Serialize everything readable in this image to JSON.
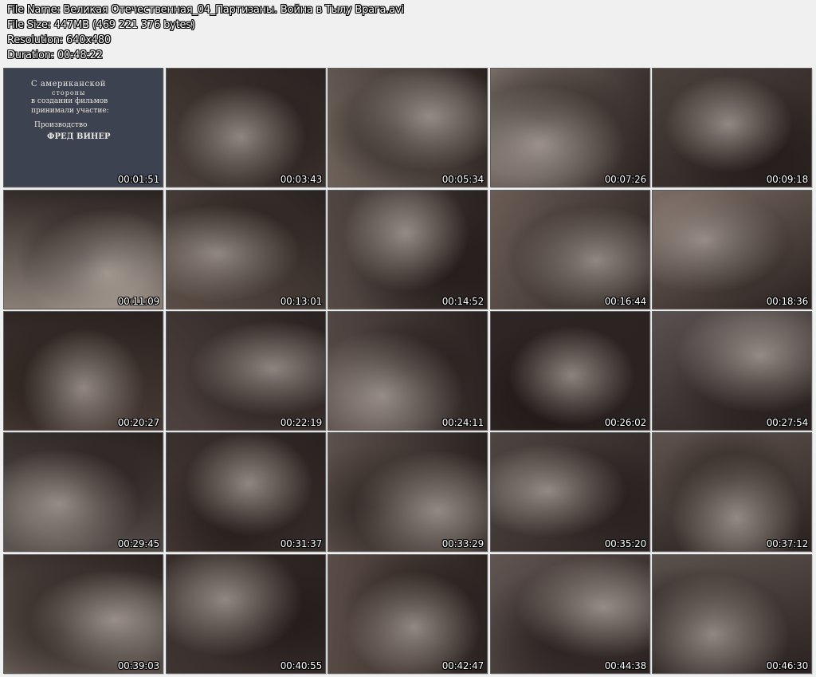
{
  "file_info": {
    "name": "File Name: Великая Отечественная_04_Партизаны. Война в Тылу Врага.avi",
    "size": "File Size: 447MB (469 221 376 bytes)",
    "resolution": "Resolution: 640x480",
    "duration": "Duration: 00:48:22"
  },
  "credits": {
    "line1": "С американской",
    "line2": "стороны",
    "line3": "в создании фильмов",
    "line4": "принимали участие:",
    "line5": "Производство",
    "line6": "ФРЕД ВИНЕР"
  },
  "thumbnails": [
    {
      "time": "00:01:51",
      "tone": "#3c4250"
    },
    {
      "time": "00:03:43",
      "tone": "#4a3f3a"
    },
    {
      "time": "00:05:34",
      "tone": "#6e625a"
    },
    {
      "time": "00:07:26",
      "tone": "#7a6e68"
    },
    {
      "time": "00:09:18",
      "tone": "#4a403c"
    },
    {
      "time": "00:11:09",
      "tone": "#8a7f77"
    },
    {
      "time": "00:13:01",
      "tone": "#5a4d46"
    },
    {
      "time": "00:14:52",
      "tone": "#554a46"
    },
    {
      "time": "00:16:44",
      "tone": "#6a5c55"
    },
    {
      "time": "00:18:36",
      "tone": "#7a6a62"
    },
    {
      "time": "00:20:27",
      "tone": "#4c3e38"
    },
    {
      "time": "00:22:19",
      "tone": "#4e4240"
    },
    {
      "time": "00:24:11",
      "tone": "#554946"
    },
    {
      "time": "00:26:02",
      "tone": "#2e2624"
    },
    {
      "time": "00:27:54",
      "tone": "#5a5050"
    },
    {
      "time": "00:29:45",
      "tone": "#5c5450"
    },
    {
      "time": "00:31:37",
      "tone": "#433734"
    },
    {
      "time": "00:33:29",
      "tone": "#5d514c"
    },
    {
      "time": "00:35:20",
      "tone": "#4e4441"
    },
    {
      "time": "00:37:12",
      "tone": "#5e524d"
    },
    {
      "time": "00:39:03",
      "tone": "#6c605a"
    },
    {
      "time": "00:40:55",
      "tone": "#3e3432"
    },
    {
      "time": "00:42:47",
      "tone": "#5a4c46"
    },
    {
      "time": "00:44:38",
      "tone": "#615552"
    },
    {
      "time": "00:46:30",
      "tone": "#5a504c"
    }
  ]
}
